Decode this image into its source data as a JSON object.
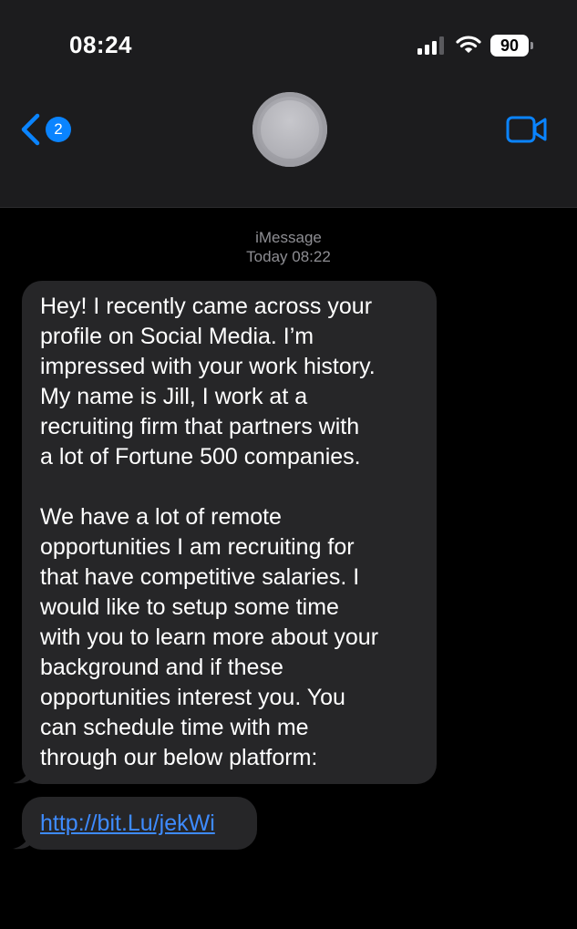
{
  "status_bar": {
    "time": "08:24",
    "battery": "90",
    "icons": [
      "cellular-signal-icon",
      "wifi-icon",
      "battery-icon"
    ]
  },
  "nav": {
    "back_badge": "2",
    "icons": [
      "chevron-left-icon",
      "contact-avatar",
      "video-camera-icon"
    ]
  },
  "conversation": {
    "service": "iMessage",
    "timestamp": "Today 08:22",
    "messages": [
      {
        "text": "Hey! I recently came across your\nprofile on Social Media. I’m\nimpressed with your work history.\nMy name is Jill, I work at a\nrecruiting firm that partners with\na lot of Fortune 500 companies.\n\nWe have a lot of remote\nopportunities I am recruiting for\nthat have competitive salaries. I\nwould like to setup some time\nwith you to learn more about your\nbackground and if these\nopportunities interest you. You\ncan schedule time with me\nthrough our below platform:"
      },
      {
        "link": "http://bit.Lu/jekWi"
      }
    ]
  },
  "colors": {
    "header_bg": "#1c1c1e",
    "bubble_bg": "#262628",
    "accent": "#0a84ff",
    "link": "#3e8bff",
    "meta_text": "#8e8e93"
  }
}
